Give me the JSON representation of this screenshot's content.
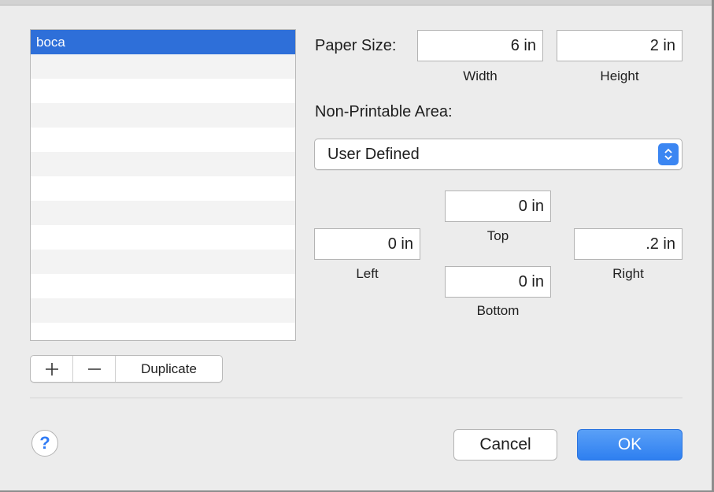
{
  "list": {
    "items": [
      {
        "label": "boca",
        "selected": true
      }
    ]
  },
  "list_controls": {
    "add_icon": "plus-icon",
    "remove_icon": "minus-icon",
    "duplicate_label": "Duplicate"
  },
  "paper_size": {
    "label": "Paper Size:",
    "width_value": "6 in",
    "height_value": "2 in",
    "width_caption": "Width",
    "height_caption": "Height"
  },
  "non_printable": {
    "label": "Non-Printable Area:",
    "popup_value": "User Defined",
    "popup_icon": "up-down-chevron-icon",
    "top_value": "0 in",
    "top_caption": "Top",
    "left_value": "0 in",
    "left_caption": "Left",
    "right_value": ".2 in",
    "right_caption": "Right",
    "bottom_value": "0 in",
    "bottom_caption": "Bottom"
  },
  "footer": {
    "help_label": "?",
    "cancel_label": "Cancel",
    "ok_label": "OK"
  },
  "colors": {
    "accent": "#2e6fd9",
    "button_blue": "#3b86f2",
    "help_blue": "#2f7bf5"
  }
}
